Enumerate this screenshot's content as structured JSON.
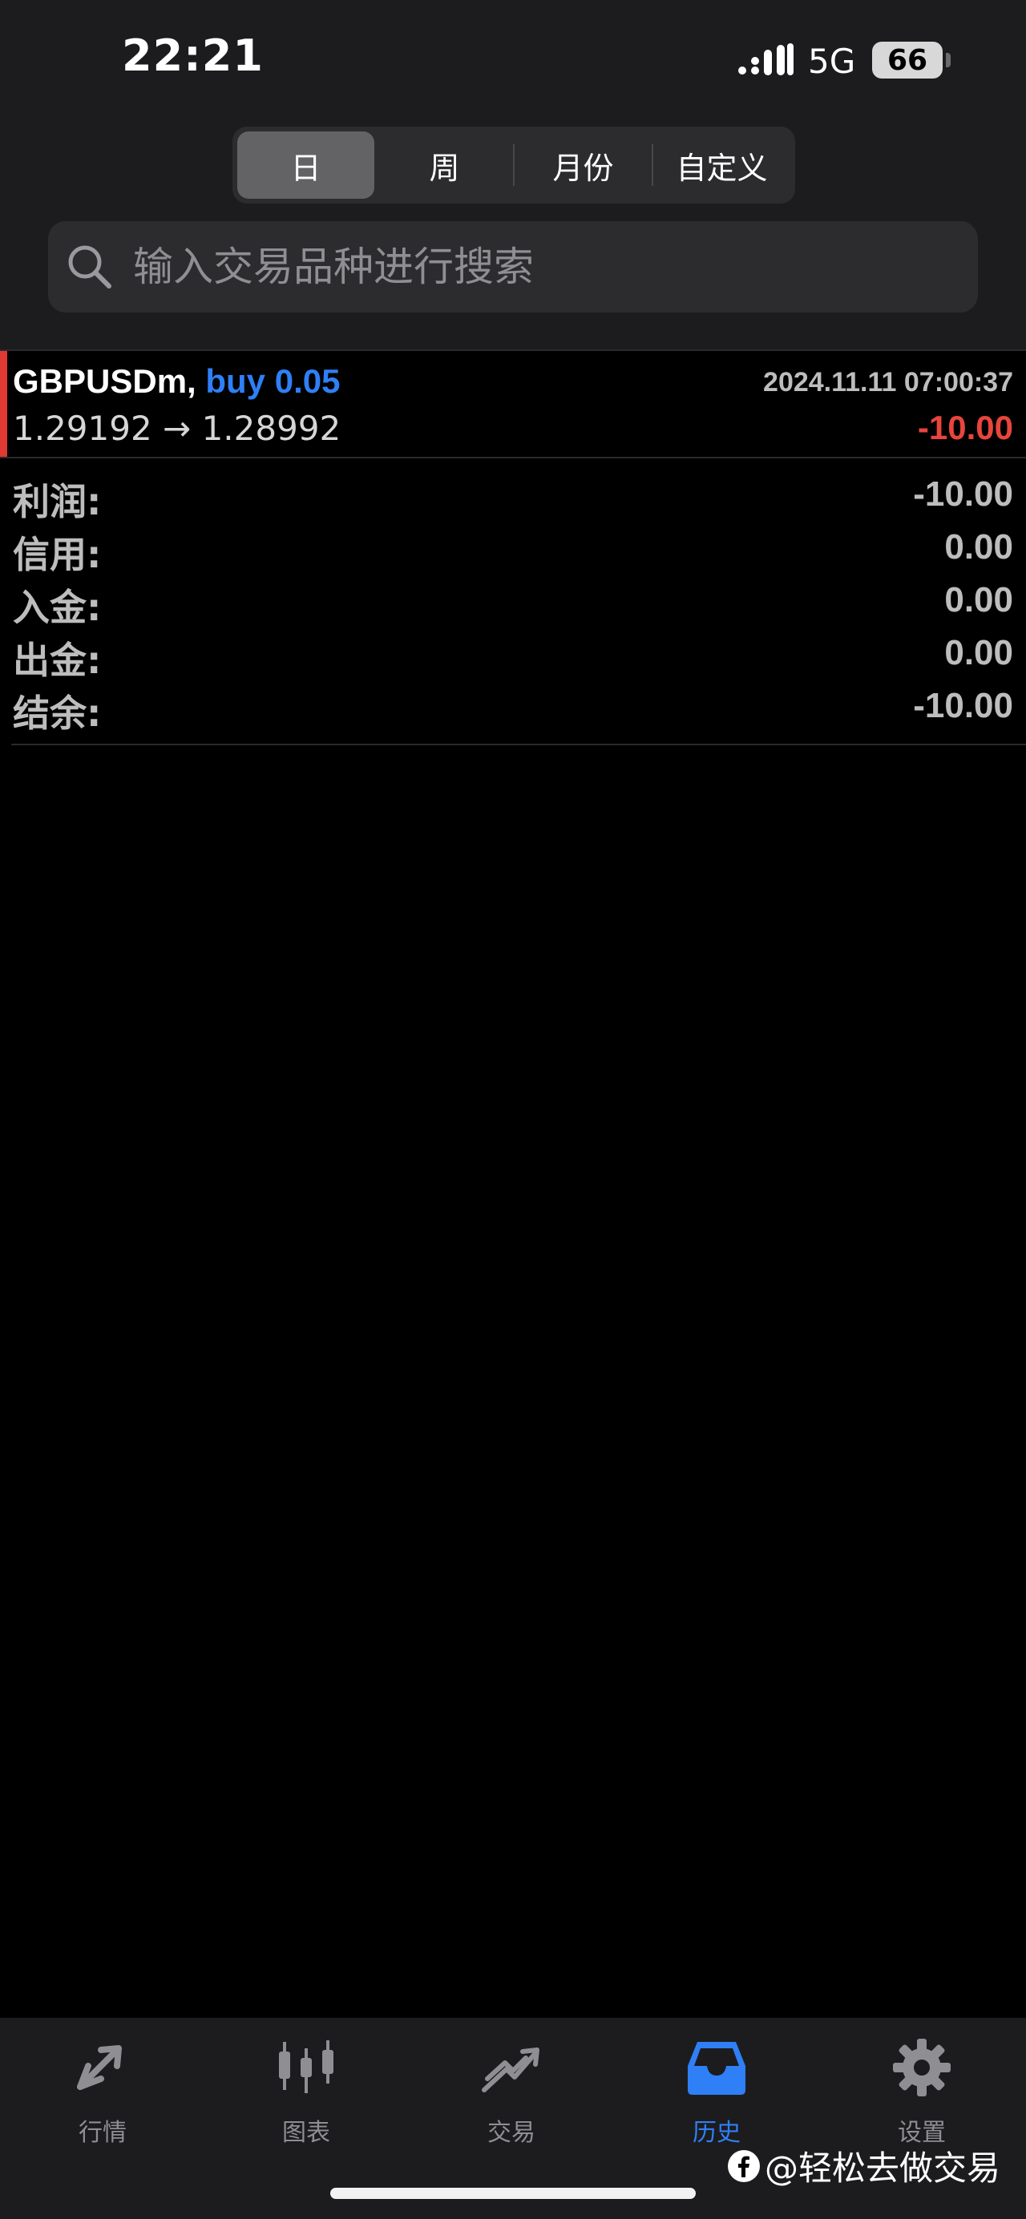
{
  "status_bar": {
    "time": "22:21",
    "network": "5G",
    "battery": "66"
  },
  "period_tabs": [
    {
      "label": "日",
      "active": true
    },
    {
      "label": "周",
      "active": false
    },
    {
      "label": "月份",
      "active": false
    },
    {
      "label": "自定义",
      "active": false
    }
  ],
  "search": {
    "placeholder": "输入交易品种进行搜索",
    "icon": "search-icon"
  },
  "trade": {
    "symbol": "GBPUSDm,",
    "side": "buy 0.05",
    "time": "2024.11.11 07:00:37",
    "prices": "1.29192 → 1.28992",
    "profit": "-10.00",
    "indicator_color": "#e03a33",
    "side_color": "#2f7ff6",
    "profit_color": "#e8453c"
  },
  "summary": [
    {
      "label": "利润:",
      "value": "-10.00"
    },
    {
      "label": "信用:",
      "value": "0.00"
    },
    {
      "label": "入金:",
      "value": "0.00"
    },
    {
      "label": "出金:",
      "value": "0.00"
    },
    {
      "label": "结余:",
      "value": "-10.00"
    }
  ],
  "tabbar": [
    {
      "label": "行情",
      "icon": "quotes-icon",
      "active": false
    },
    {
      "label": "图表",
      "icon": "chart-icon",
      "active": false
    },
    {
      "label": "交易",
      "icon": "trade-icon",
      "active": false
    },
    {
      "label": "历史",
      "icon": "history-icon",
      "active": true
    },
    {
      "label": "设置",
      "icon": "settings-icon",
      "active": false
    }
  ],
  "watermark": "@轻松去做交易",
  "colors": {
    "accent": "#2f7ff6",
    "loss": "#e8453c"
  }
}
